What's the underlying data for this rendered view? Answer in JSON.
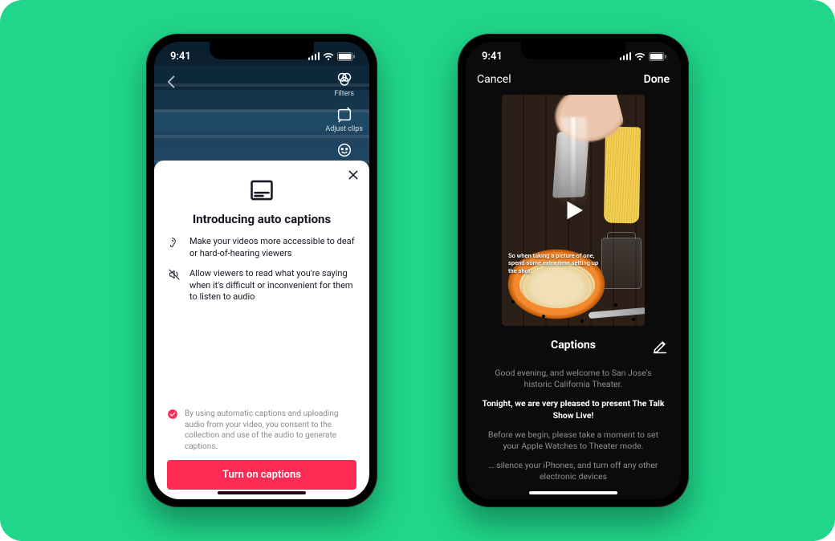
{
  "status": {
    "time": "9:41"
  },
  "phone1": {
    "side": {
      "filters": "Filters",
      "adjust": "Adjust clips"
    },
    "sheet": {
      "title": "Introducing auto captions",
      "bullet1": "Make your videos more accessible to deaf or hard-of-hearing viewers",
      "bullet2": "Allow viewers to read what you're saying when it's difficult or inconvenient for them to listen to audio",
      "consent": "By using automatic captions and uploading audio from your video, you consent to the collection and use of the audio to generate captions.",
      "cta": "Turn on captions"
    }
  },
  "phone2": {
    "nav": {
      "cancel": "Cancel",
      "done": "Done"
    },
    "video_caption": "So when taking a picture of one, spend some extra time setting up the shot.",
    "captions": {
      "title": "Captions",
      "lines": {
        "l1": "Good evening, and welcome to San Jose's historic California Theater.",
        "l2": "Tonight, we are very pleased to present The Talk Show Live!",
        "l3": "Before we begin, please take a moment to set your Apple Watches to Theater mode.",
        "l4": "… silence your iPhones, and turn off any other electronic devices"
      }
    }
  }
}
